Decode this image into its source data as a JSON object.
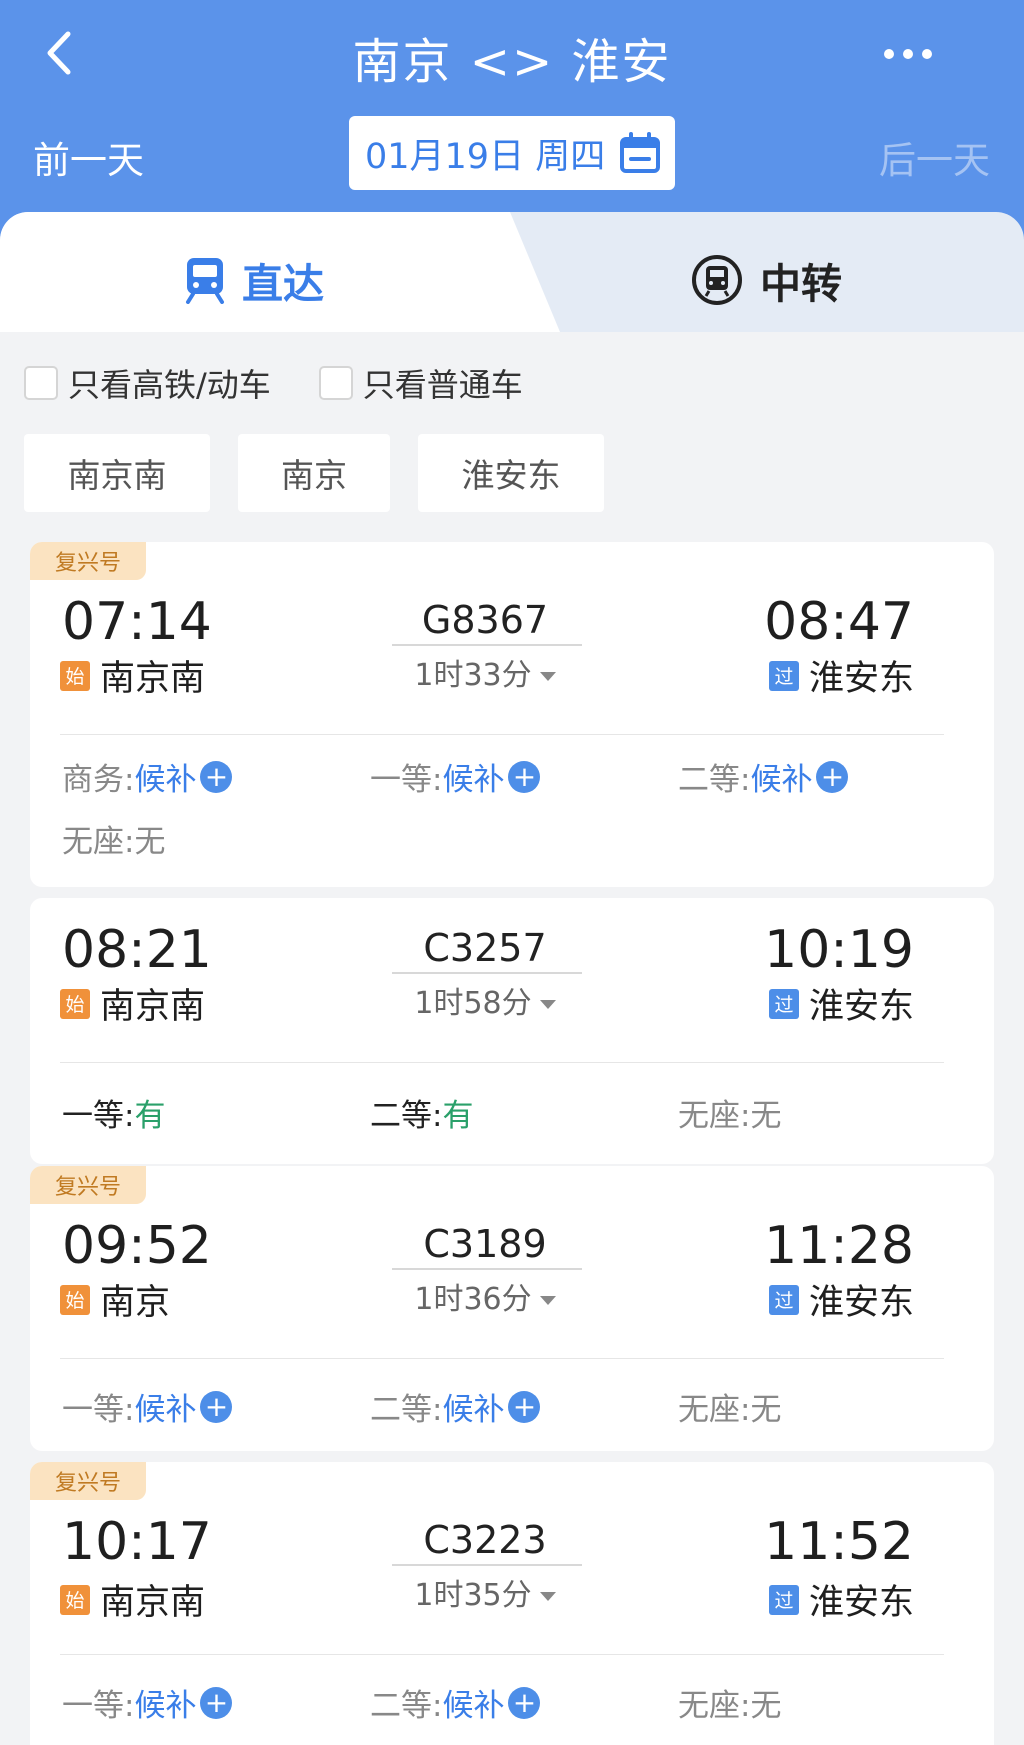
{
  "header": {
    "title": "南京 <> 淮安",
    "prev_day": "前一天",
    "next_day": "后一天",
    "date": "01月19日 周四"
  },
  "tabs": {
    "direct": "直达",
    "transfer": "中转"
  },
  "filters": {
    "high_speed": "只看高铁/动车",
    "normal": "只看普通车"
  },
  "stations": [
    "南京南",
    "南京",
    "淮安东"
  ],
  "tags": {
    "start": "始",
    "pass": "过"
  },
  "trains": [
    {
      "badge": "复兴号",
      "dep_time": "07:14",
      "train_no": "G8367",
      "duration": "1时33分",
      "arr_time": "08:47",
      "dep_station": "南京南",
      "arr_station": "淮安东",
      "seats_row1": [
        {
          "label": "商务: ",
          "value": "候补",
          "kind": "waitlist"
        },
        {
          "label": "一等: ",
          "value": "候补",
          "kind": "waitlist"
        },
        {
          "label": "二等: ",
          "value": "候补",
          "kind": "waitlist"
        }
      ],
      "seats_row2": [
        {
          "label": "无座: ",
          "value": "无",
          "kind": "none"
        }
      ]
    },
    {
      "badge": "",
      "dep_time": "08:21",
      "train_no": "C3257",
      "duration": "1时58分",
      "arr_time": "10:19",
      "dep_station": "南京南",
      "arr_station": "淮安东",
      "seats_row1": [
        {
          "label": "一等: ",
          "value": "有",
          "kind": "available"
        },
        {
          "label": "二等: ",
          "value": "有",
          "kind": "available"
        },
        {
          "label": "无座: ",
          "value": "无",
          "kind": "none"
        }
      ]
    },
    {
      "badge": "复兴号",
      "dep_time": "09:52",
      "train_no": "C3189",
      "duration": "1时36分",
      "arr_time": "11:28",
      "dep_station": "南京",
      "arr_station": "淮安东",
      "seats_row1": [
        {
          "label": "一等: ",
          "value": "候补",
          "kind": "waitlist"
        },
        {
          "label": "二等: ",
          "value": "候补",
          "kind": "waitlist"
        },
        {
          "label": "无座: ",
          "value": "无",
          "kind": "none"
        }
      ]
    },
    {
      "badge": "复兴号",
      "dep_time": "10:17",
      "train_no": "C3223",
      "duration": "1时35分",
      "arr_time": "11:52",
      "dep_station": "南京南",
      "arr_station": "淮安东",
      "seats_row1": [
        {
          "label": "一等: ",
          "value": "候补",
          "kind": "waitlist"
        },
        {
          "label": "二等: ",
          "value": "候补",
          "kind": "waitlist"
        },
        {
          "label": "无座: ",
          "value": "无",
          "kind": "none"
        }
      ]
    }
  ],
  "colors": {
    "header_bg": "#5b93ea",
    "accent": "#3a7ee8",
    "available": "#2aa06a",
    "badge_bg": "#fbe3c1",
    "start_tag": "#f0913a",
    "pass_tag": "#4d8ee8"
  }
}
